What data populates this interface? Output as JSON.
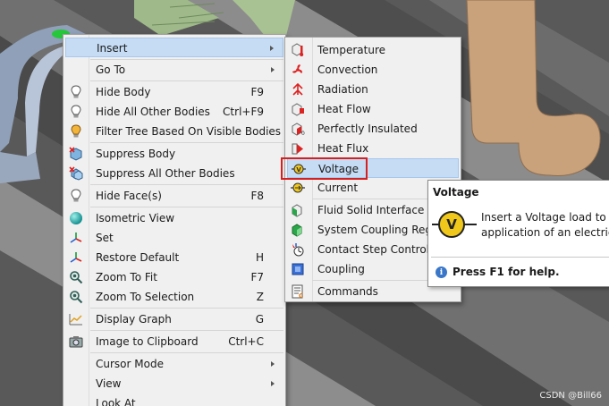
{
  "context_menu": {
    "items": [
      {
        "label": "Insert",
        "shortcut": "",
        "submenu": true,
        "icon": "none"
      },
      {
        "label": "Go To",
        "shortcut": "",
        "submenu": true,
        "icon": "none"
      },
      {
        "label": "Hide Body",
        "shortcut": "F9",
        "icon": "lightbulb-icon"
      },
      {
        "label": "Hide All Other Bodies",
        "shortcut": "Ctrl+F9",
        "icon": "lightbulb-icon"
      },
      {
        "label": "Filter Tree Based On Visible Bodies",
        "shortcut": "",
        "icon": "lightbulb-filter-icon"
      },
      {
        "label": "Suppress Body",
        "shortcut": "",
        "icon": "suppress-body-icon"
      },
      {
        "label": "Suppress All Other Bodies",
        "shortcut": "",
        "icon": "suppress-bodies-icon"
      },
      {
        "label": "Hide Face(s)",
        "shortcut": "F8",
        "icon": "lightbulb-icon"
      },
      {
        "label": "Isometric View",
        "shortcut": "",
        "icon": "sphere-icon"
      },
      {
        "label": "Set",
        "shortcut": "",
        "icon": "axis-triad-icon"
      },
      {
        "label": "Restore Default",
        "shortcut": "H",
        "icon": "axis-triad-icon"
      },
      {
        "label": "Zoom To Fit",
        "shortcut": "F7",
        "icon": "zoom-icon"
      },
      {
        "label": "Zoom To Selection",
        "shortcut": "Z",
        "icon": "zoom-icon"
      },
      {
        "label": "Display Graph",
        "shortcut": "G",
        "icon": "graph-icon"
      },
      {
        "label": "Image to Clipboard",
        "shortcut": "Ctrl+C",
        "icon": "camera-icon"
      },
      {
        "label": "Cursor Mode",
        "shortcut": "",
        "submenu": true,
        "icon": "none"
      },
      {
        "label": "View",
        "shortcut": "",
        "submenu": true,
        "icon": "none"
      },
      {
        "label": "Look At",
        "shortcut": "",
        "icon": "none"
      }
    ]
  },
  "insert_submenu": {
    "items": [
      {
        "label": "Temperature",
        "icon": "temperature-icon"
      },
      {
        "label": "Convection",
        "icon": "convection-fan-icon"
      },
      {
        "label": "Radiation",
        "icon": "radiation-icon"
      },
      {
        "label": "Heat Flow",
        "icon": "heat-flow-icon"
      },
      {
        "label": "Perfectly Insulated",
        "icon": "perfectly-insulated-icon"
      },
      {
        "label": "Heat Flux",
        "icon": "heat-flux-icon"
      },
      {
        "label": "Voltage",
        "icon": "voltage-icon"
      },
      {
        "label": "Current",
        "icon": "current-icon"
      },
      {
        "label": "Fluid Solid Interface",
        "icon": "fluid-solid-interface-icon"
      },
      {
        "label": "System Coupling Region",
        "icon": "system-coupling-icon"
      },
      {
        "label": "Contact Step Control",
        "icon": "contact-step-icon"
      },
      {
        "label": "Coupling",
        "icon": "coupling-icon"
      },
      {
        "label": "Commands",
        "icon": "commands-icon"
      }
    ]
  },
  "tooltip": {
    "title": "Voltage",
    "icon_letter": "V",
    "line1": "Insert a Voltage load to",
    "line2": "application of an electric",
    "help": "Press F1 for help."
  },
  "watermark": "CSDN @Bill66",
  "colors": {
    "highlight": "#c5dcf4",
    "menu_bg": "#f0f0f0",
    "red_frame": "#d62020",
    "voltage_yellow": "#f0c81c"
  }
}
